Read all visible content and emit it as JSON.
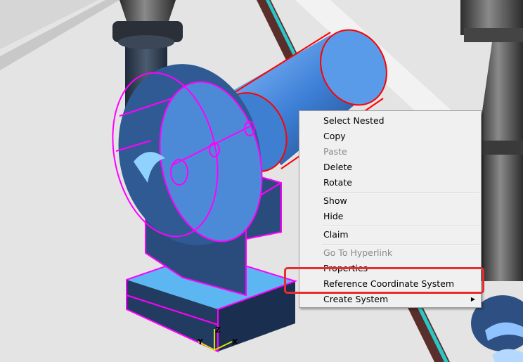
{
  "context_menu": {
    "items": [
      {
        "label": "Select Nested",
        "enabled": true
      },
      {
        "label": "Copy",
        "enabled": true
      },
      {
        "label": "Paste",
        "enabled": false
      },
      {
        "label": "Delete",
        "enabled": true
      },
      {
        "label": "Rotate",
        "enabled": true
      },
      {
        "label": "Show",
        "enabled": true
      },
      {
        "label": "Hide",
        "enabled": true
      },
      {
        "label": "Claim",
        "enabled": true
      },
      {
        "label": "Go To Hyperlink",
        "enabled": false
      },
      {
        "label": "Properties",
        "enabled": true
      },
      {
        "label": "Reference Coordinate System",
        "enabled": true
      },
      {
        "label": "Create System",
        "enabled": true,
        "submenu": true
      }
    ]
  },
  "highlight": {
    "target": "Reference Coordinate System",
    "color": "#e62e2e"
  },
  "axes": {
    "x": "X",
    "y": "Y",
    "z": "Z"
  },
  "colors": {
    "selection_magenta": "#ff00ff",
    "selection_red": "#ff0000",
    "model_blue": "#4d8fe0",
    "pipe_dark": "#2f3947"
  }
}
